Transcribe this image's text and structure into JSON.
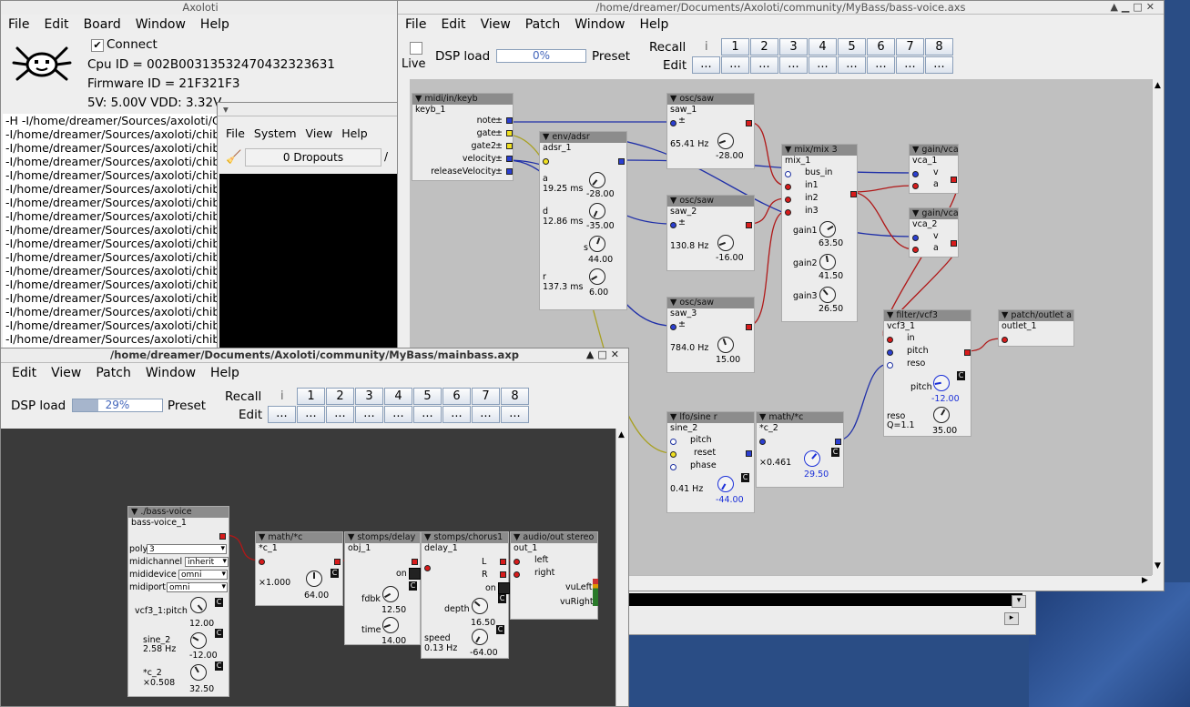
{
  "main_window": {
    "title": "Axoloti",
    "menu": [
      "File",
      "Edit",
      "Board",
      "Window",
      "Help"
    ],
    "connect_label": "Connect",
    "connect_checked": true,
    "cpu_id": "Cpu ID = 002B00313532470432323631",
    "firmware_id": "Firmware ID = 21F321F3",
    "voltages": "5V: 5.00V VDD: 3.32V",
    "log_lines": [
      "-H -I/home/dreamer/Sources/axoloti/C",
      "-I/home/dreamer/Sources/axoloti/chib",
      "-I/home/dreamer/Sources/axoloti/chib",
      "-I/home/dreamer/Sources/axoloti/chib",
      "-I/home/dreamer/Sources/axoloti/chib",
      "-I/home/dreamer/Sources/axoloti/chib",
      "-I/home/dreamer/Sources/axoloti/chib",
      "-I/home/dreamer/Sources/axoloti/chib",
      "-I/home/dreamer/Sources/axoloti/chib",
      "-I/home/dreamer/Sources/axoloti/chib",
      "-I/home/dreamer/Sources/axoloti/chib",
      "-I/home/dreamer/Sources/axoloti/chib",
      "-I/home/dreamer/Sources/axoloti/chib",
      "-I/home/dreamer/Sources/axoloti/chib",
      "-I/home/dreamer/Sources/axoloti/chib",
      "-I/home/dreamer/Sources/axoloti/chib",
      "-I/home/dreamer/Sources/axoloti/chib"
    ]
  },
  "tool_window": {
    "menu": [
      "File",
      "System",
      "View",
      "Help"
    ],
    "dropouts": "0 Dropouts",
    "slash": "/"
  },
  "voice_window": {
    "title": "/home/dreamer/Documents/Axoloti/community/MyBass/bass-voice.axs",
    "menu": [
      "File",
      "Edit",
      "View",
      "Patch",
      "Window",
      "Help"
    ],
    "live_label": "Live",
    "dsp_load_label": "DSP load",
    "dsp_load_value": "0%",
    "dsp_load_fraction": 0,
    "preset_label": "Preset",
    "recall_label": "Recall",
    "edit_label": "Edit",
    "preset_info": "i",
    "preset_numbers": [
      "1",
      "2",
      "3",
      "4",
      "5",
      "6",
      "7",
      "8"
    ],
    "edit_buttons": [
      "...",
      "...",
      "...",
      "...",
      "...",
      "...",
      "...",
      "...",
      "..."
    ]
  },
  "voice_objects": {
    "keyb": {
      "type": "▼ midi/in/keyb",
      "name": "keyb_1",
      "outs": [
        "note",
        "gate",
        "gate2",
        "velocity",
        "releaseVelocity"
      ]
    },
    "adsr": {
      "type": "▼ env/adsr",
      "name": "adsr_1",
      "a": "a",
      "a_val": "19.25 ms",
      "a_knob": "-28.00",
      "d": "d",
      "d_val": "12.86 ms",
      "d_knob": "-35.00",
      "s": "s",
      "s_knob": "44.00",
      "r": "r",
      "r_val": "137.3 ms",
      "r_knob": "6.00"
    },
    "saw1": {
      "type": "▼ osc/saw",
      "name": "saw_1",
      "freq": "65.41 Hz",
      "knob": "-28.00"
    },
    "saw2": {
      "type": "▼ osc/saw",
      "name": "saw_2",
      "freq": "130.8 Hz",
      "knob": "-16.00"
    },
    "saw3": {
      "type": "▼ osc/saw",
      "name": "saw_3",
      "freq": "784.0 Hz",
      "knob": "15.00"
    },
    "mix": {
      "type": "▼ mix/mix 3",
      "name": "mix_1",
      "ins": [
        "bus_in",
        "in1",
        "in2",
        "in3"
      ],
      "gain1": "gain1",
      "gain1_val": "63.50",
      "gain2": "gain2",
      "gain2_val": "41.50",
      "gain3": "gain3",
      "gain3_val": "26.50"
    },
    "vca1": {
      "type": "▼ gain/vca",
      "name": "vca_1",
      "v": "v",
      "a": "a"
    },
    "vca2": {
      "type": "▼ gain/vca",
      "name": "vca_2",
      "v": "v",
      "a": "a"
    },
    "vcf": {
      "type": "▼ filter/vcf3",
      "name": "vcf3_1",
      "in": "in",
      "pitch": "pitch",
      "reso": "reso",
      "pitch_label": "pitch",
      "pitch_val": "-12.00",
      "reso_label": "reso",
      "reso_q": "Q=1.1",
      "reso_val": "35.00"
    },
    "outlet": {
      "type": "▼ patch/outlet a",
      "name": "outlet_1"
    },
    "lfo": {
      "type": "▼ lfo/sine r",
      "name": "sine_2",
      "pitch": "pitch",
      "reset": "reset",
      "phase": "phase",
      "freq": "0.41 Hz",
      "knob": "-44.00"
    },
    "mathc": {
      "type": "▼ math/*c",
      "name": "*c_2",
      "mult": "×0.461",
      "knob": "29.50"
    }
  },
  "main_patch_window": {
    "title": "/home/dreamer/Documents/Axoloti/community/MyBass/mainbass.axp",
    "menu": [
      "Edit",
      "View",
      "Patch",
      "Window",
      "Help"
    ],
    "dsp_load_label": "DSP load",
    "dsp_load_value": "29%",
    "dsp_load_fraction": 0.29,
    "preset_label": "Preset",
    "recall_label": "Recall",
    "edit_label": "Edit",
    "preset_info": "i",
    "preset_numbers": [
      "1",
      "2",
      "3",
      "4",
      "5",
      "6",
      "7",
      "8"
    ],
    "edit_buttons": [
      "...",
      "...",
      "...",
      "...",
      "...",
      "...",
      "...",
      "...",
      "..."
    ]
  },
  "main_objects": {
    "bassvoice": {
      "type": "▼ ./bass-voice",
      "name": "bass-voice_1",
      "poly": "poly",
      "poly_val": "3",
      "midichannel": "midichannel",
      "midichannel_val": "inherit",
      "mididevice": "mididevice",
      "mididevice_val": "omni",
      "midiport": "midiport",
      "midiport_val": "omni",
      "p1": "vcf3_1:pitch",
      "p1_val": "12.00",
      "p2": "sine_2",
      "p2_sub": "2.58 Hz",
      "p2_val": "-12.00",
      "p3": "*c_2",
      "p3_sub": "×0.508",
      "p3_val": "32.50"
    },
    "mathc1": {
      "type": "▼ math/*c",
      "name": "*c_1",
      "mult": "×1.000",
      "knob": "64.00"
    },
    "delay": {
      "type": "▼ stomps/delay",
      "name": "obj_1",
      "on": "on",
      "fdbk": "fdbk",
      "fdbk_val": "12.50",
      "time": "time",
      "time_val": "14.00"
    },
    "chorus": {
      "type": "▼ stomps/chorus1",
      "name": "delay_1",
      "L": "L",
      "R": "R",
      "on": "on",
      "depth": "depth",
      "depth_val": "16.50",
      "speed": "speed",
      "speed_sub": "0.13 Hz",
      "speed_val": "-64.00"
    },
    "audioout": {
      "type": "▼ audio/out stereo",
      "name": "out_1",
      "left": "left",
      "right": "right",
      "vuLeft": "vuLeft",
      "vuRight": "vuRight"
    }
  },
  "colors": {
    "wire_blue": "#1f2fa8",
    "wire_red": "#b01818",
    "wire_yellow": "#a8a020",
    "canvas": "#c0c0c0",
    "desktop": "#2a4d85"
  }
}
